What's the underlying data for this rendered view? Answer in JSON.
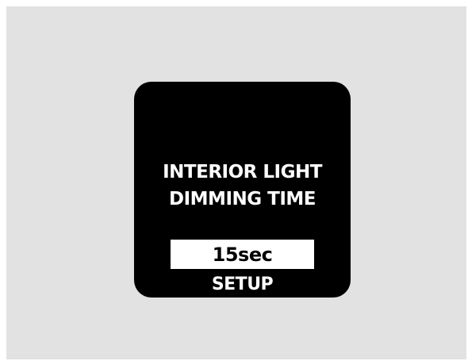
{
  "display": {
    "title_line1": "INTERIOR LIGHT",
    "title_line2": "DIMMING TIME",
    "value": "15sec",
    "action_label": "SETUP"
  },
  "colors": {
    "background": "#e2e2e2",
    "screen": "#000000",
    "text": "#ffffff",
    "value_box": "#ffffff"
  }
}
